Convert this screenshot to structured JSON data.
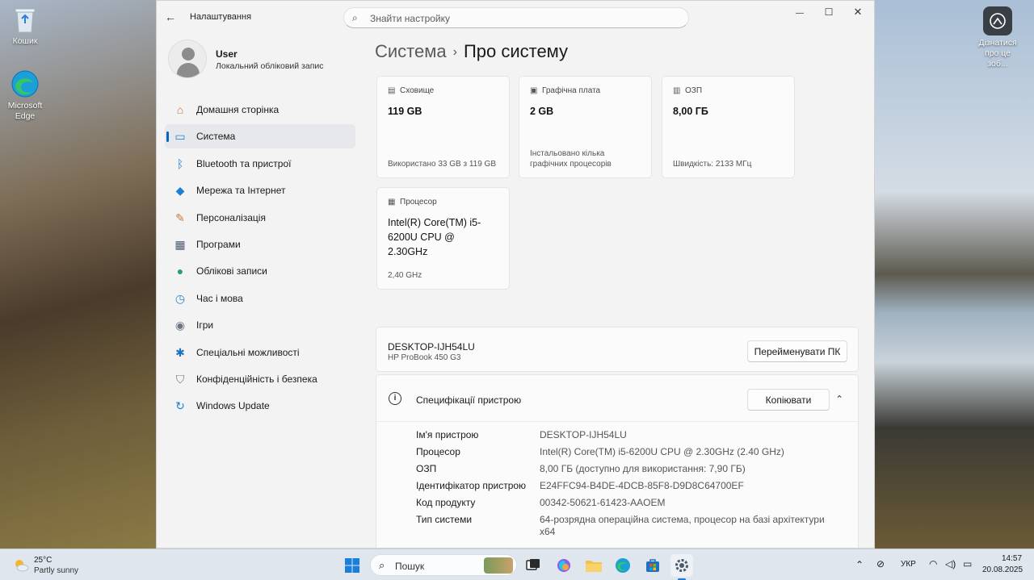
{
  "desktop": {
    "icons": [
      {
        "label": "Кошик"
      },
      {
        "label": "Microsoft Edge"
      }
    ],
    "spotlight_label": "Дізнатися про це зоб..."
  },
  "window": {
    "app_title": "Налаштування",
    "search_placeholder": "Знайти настройку",
    "controls": {
      "minimize": "—",
      "maximize": "☐",
      "close": "✕"
    }
  },
  "profile": {
    "name": "User",
    "subtitle": "Локальний обліковий запис"
  },
  "sidebar": {
    "items": [
      {
        "label": "Домашня сторінка",
        "icon": "home-icon",
        "color": "#d9733b"
      },
      {
        "label": "Система",
        "icon": "system-icon",
        "color": "#1e88d6"
      },
      {
        "label": "Bluetooth та пристрої",
        "icon": "bluetooth-icon",
        "color": "#1b7fd4"
      },
      {
        "label": "Мережа та Інтернет",
        "icon": "wifi-icon",
        "color": "#1b7fd4"
      },
      {
        "label": "Персоналізація",
        "icon": "brush-icon",
        "color": "#c9783e"
      },
      {
        "label": "Програми",
        "icon": "apps-icon",
        "color": "#4d5b6b"
      },
      {
        "label": "Облікові записи",
        "icon": "accounts-icon",
        "color": "#22a07a"
      },
      {
        "label": "Час і мова",
        "icon": "time-language-icon",
        "color": "#2a88c8"
      },
      {
        "label": "Ігри",
        "icon": "gaming-icon",
        "color": "#6d7680"
      },
      {
        "label": "Спеціальні можливості",
        "icon": "accessibility-icon",
        "color": "#1f6fc2"
      },
      {
        "label": "Конфіденційність і безпека",
        "icon": "shield-icon",
        "color": "#6d7680"
      },
      {
        "label": "Windows Update",
        "icon": "update-icon",
        "color": "#1b7fd4"
      }
    ],
    "active_index": 1
  },
  "breadcrumb": {
    "parent": "Система",
    "separator": "›",
    "current": "Про систему"
  },
  "cards": {
    "storage": {
      "title": "Сховище",
      "value": "119 GB",
      "footer": "Використано 33 GB з 119 GB"
    },
    "gpu": {
      "title": "Графічна плата",
      "value": "2 GB",
      "footer": "Інстальовано кілька графічних процесорів"
    },
    "ram": {
      "title": "ОЗП",
      "value": "8,00 ГБ",
      "footer": "Швидкість: 2133 МГц"
    },
    "cpu": {
      "title": "Процесор",
      "value": "Intel(R) Core(TM) i5-6200U CPU @ 2.30GHz",
      "footer": "2,40 GHz"
    }
  },
  "device": {
    "name": "DESKTOP-IJH54LU",
    "model": "HP ProBook 450 G3",
    "rename_button": "Перейменувати ПК"
  },
  "specs": {
    "title": "Специфікації пристрою",
    "copy_button": "Копіювати",
    "rows": [
      {
        "label": "Ім'я пристрою",
        "value": "DESKTOP-IJH54LU"
      },
      {
        "label": "Процесор",
        "value": "Intel(R) Core(TM) i5-6200U CPU @ 2.30GHz (2.40 GHz)"
      },
      {
        "label": "ОЗП",
        "value": "8,00 ГБ (доступно для використання: 7,90 ГБ)"
      },
      {
        "label": "Ідентифікатор пристрою",
        "value": "E24FFC94-B4DE-4DCB-85F8-D9D8C64700EF"
      },
      {
        "label": "Код продукту",
        "value": "00342-50621-61423-AAOEM"
      },
      {
        "label": "Тип системи",
        "value": "64-розрядна операційна система, процесор на базі архітектури x64"
      }
    ]
  },
  "taskbar": {
    "weather_temp": "25°C",
    "weather_desc": "Partly sunny",
    "search_label": "Пошук",
    "language": "УКР",
    "time": "14:57",
    "date": "20.08.2025"
  }
}
